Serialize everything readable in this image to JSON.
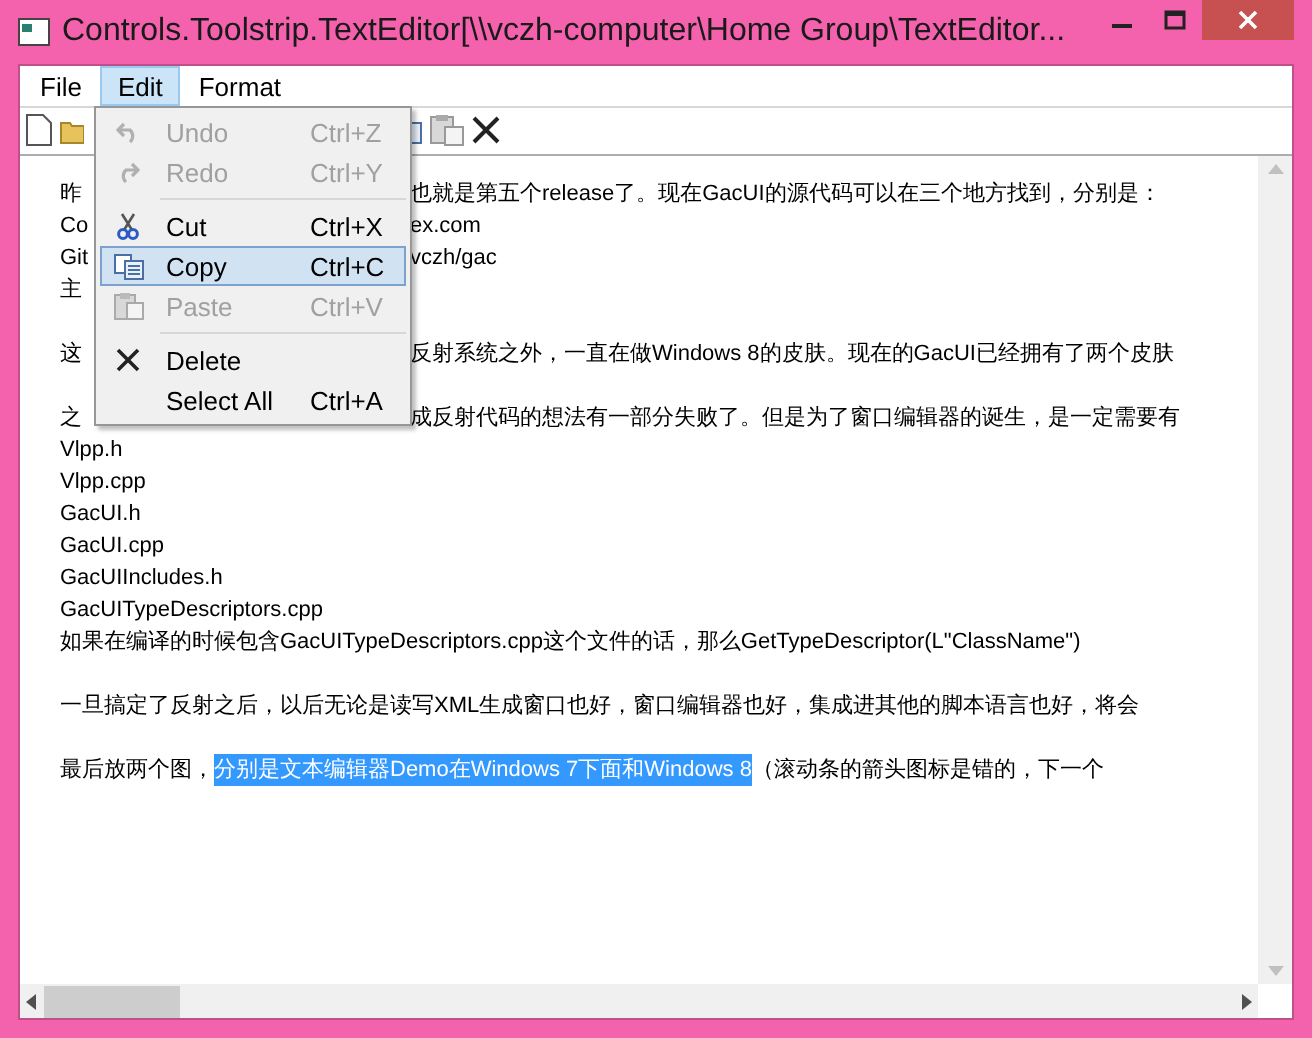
{
  "window": {
    "title": "Controls.Toolstrip.TextEditor[\\\\vczh-computer\\Home Group\\TextEditor..."
  },
  "menubar": [
    {
      "label": "File",
      "selected": false
    },
    {
      "label": "Edit",
      "selected": true
    },
    {
      "label": "Format",
      "selected": false
    }
  ],
  "edit_menu": {
    "items": [
      {
        "kind": "item",
        "label": "Undo",
        "shortcut": "Ctrl+Z",
        "disabled": true,
        "selected": false
      },
      {
        "kind": "item",
        "label": "Redo",
        "shortcut": "Ctrl+Y",
        "disabled": true,
        "selected": false
      },
      {
        "kind": "separator"
      },
      {
        "kind": "item",
        "label": "Cut",
        "shortcut": "Ctrl+X",
        "disabled": false,
        "selected": false
      },
      {
        "kind": "item",
        "label": "Copy",
        "shortcut": "Ctrl+C",
        "disabled": false,
        "selected": true
      },
      {
        "kind": "item",
        "label": "Paste",
        "shortcut": "Ctrl+V",
        "disabled": true,
        "selected": false
      },
      {
        "kind": "separator"
      },
      {
        "kind": "item",
        "label": "Delete",
        "disabled": false,
        "selected": false
      },
      {
        "kind": "item",
        "label": "Select All",
        "shortcut": "Ctrl+A",
        "disabled": false,
        "selected": false
      }
    ]
  },
  "editor": {
    "lines": [
      {
        "kind": "split",
        "left": "昨",
        "right": "也就是第五个release了。现在GacUI的源代码可以在三个地方找到，分别是："
      },
      {
        "kind": "split",
        "left": "Co",
        "right": "ex.com"
      },
      {
        "kind": "split",
        "left": "Git",
        "right": "vczh/gac"
      },
      {
        "kind": "split",
        "left": "主"
      },
      {
        "kind": "blank"
      },
      {
        "kind": "split",
        "left": "这",
        "right": "反射系统之外，一直在做Windows 8的皮肤。现在的GacUI已经拥有了两个皮肤"
      },
      {
        "kind": "blank"
      },
      {
        "kind": "split",
        "left": "之",
        "right": "成反射代码的想法有一部分失败了。但是为了窗口编辑器的诞生，是一定需要有"
      },
      {
        "kind": "plain",
        "text": "Vlpp.h"
      },
      {
        "kind": "plain",
        "text": "Vlpp.cpp"
      },
      {
        "kind": "plain",
        "text": "GacUI.h"
      },
      {
        "kind": "plain",
        "text": "GacUI.cpp"
      },
      {
        "kind": "plain",
        "text": "GacUIIncludes.h"
      },
      {
        "kind": "plain",
        "text": "GacUITypeDescriptors.cpp"
      },
      {
        "kind": "plain",
        "text": "如果在编译的时候包含GacUITypeDescriptors.cpp这个文件的话，那么GetTypeDescriptor(L\"ClassName\")"
      },
      {
        "kind": "blank"
      },
      {
        "kind": "plain",
        "text": "一旦搞定了反射之后，以后无论是读写XML生成窗口也好，窗口编辑器也好，集成进其他的脚本语言也好，将会"
      },
      {
        "kind": "blank"
      },
      {
        "kind": "spans",
        "spans": [
          {
            "text": "最后放两个图，",
            "selected": false
          },
          {
            "text": "分别是文本编辑器Demo在Windows 7下面和Windows 8",
            "selected": true
          },
          {
            "text": "（滚动条的箭头图标是错的，下一个",
            "selected": false
          }
        ]
      }
    ]
  }
}
